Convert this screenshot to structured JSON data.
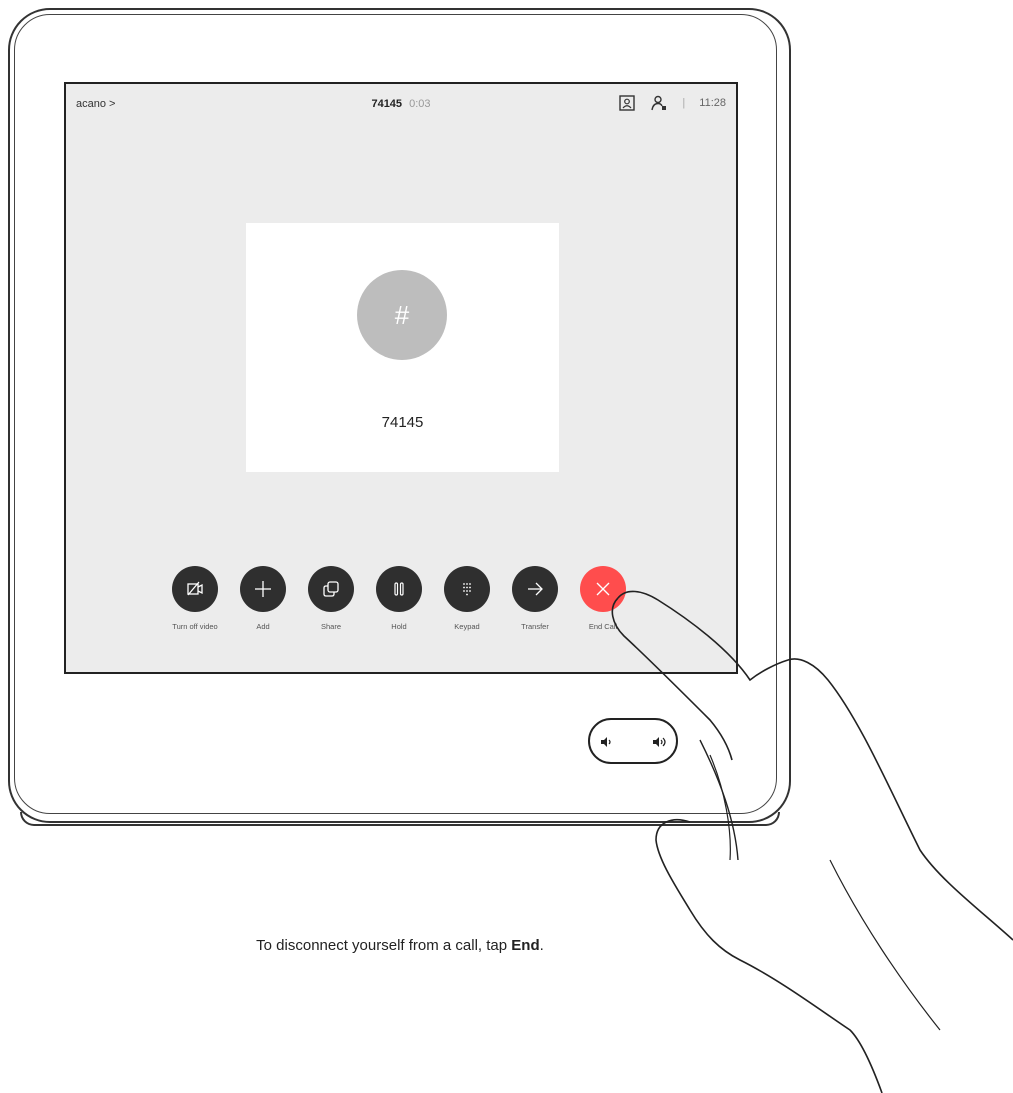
{
  "status_bar": {
    "left_label": "acano >",
    "call_number": "74145",
    "call_duration": "0:03",
    "time": "11:28",
    "self_view_icon": "self-view-icon",
    "participants_icon": "participants-icon"
  },
  "contact": {
    "avatar_glyph": "#",
    "name": "74145"
  },
  "controls": [
    {
      "label": "Turn off video",
      "icon": "video-off-icon"
    },
    {
      "label": "Add",
      "icon": "plus-icon"
    },
    {
      "label": "Share",
      "icon": "share-icon"
    },
    {
      "label": "Hold",
      "icon": "pause-icon"
    },
    {
      "label": "Keypad",
      "icon": "keypad-icon"
    },
    {
      "label": "Transfer",
      "icon": "arrow-right-icon"
    },
    {
      "label": "End Call",
      "icon": "close-icon"
    }
  ],
  "colors": {
    "end_call": "#ff4d4d",
    "button_dark": "#2f2f2f",
    "screen_bg": "#ececec"
  },
  "caption": {
    "prefix": "To disconnect yourself from a call, tap ",
    "emphasis": "End",
    "suffix": "."
  }
}
